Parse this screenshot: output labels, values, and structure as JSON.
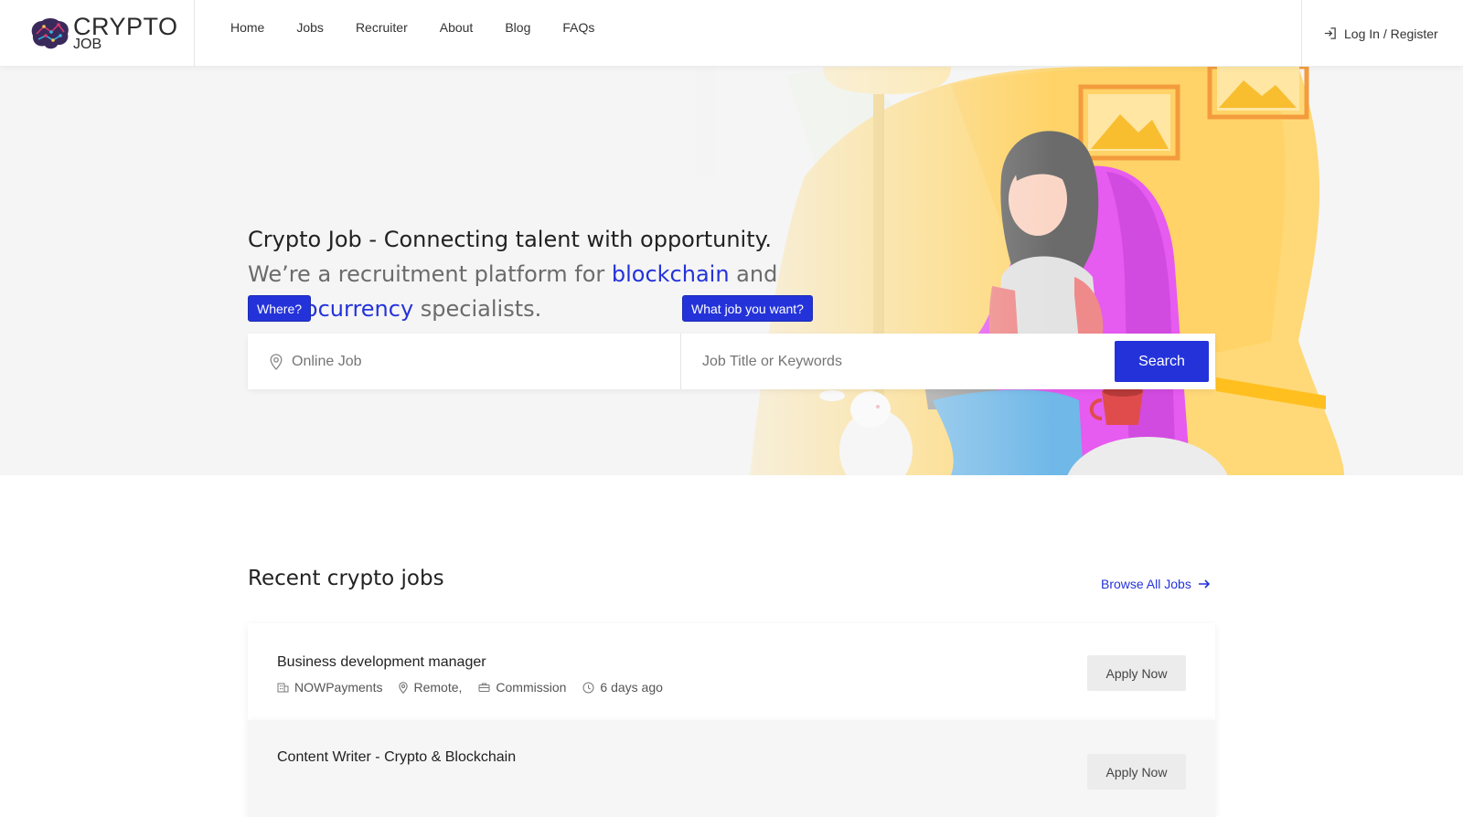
{
  "brand": {
    "line1": "CRYPTO",
    "line2": "JOB"
  },
  "nav": {
    "items": [
      "Home",
      "Jobs",
      "Recruiter",
      "About",
      "Blog",
      "FAQs"
    ]
  },
  "auth": {
    "label": "Log In / Register"
  },
  "hero": {
    "headline": "Crypto Job - Connecting talent with opportunity.",
    "sub_prefix": "We’re a recruitment platform for ",
    "sub_highlight1": "blockchain",
    "sub_mid": " and",
    "sub_highlight2": "cryptocurrency",
    "sub_suffix": " specialists."
  },
  "search": {
    "where_label": "Where?",
    "what_label": "What job you want?",
    "where_placeholder": "Online Job",
    "what_placeholder": "Job Title or Keywords",
    "button": "Search"
  },
  "recent": {
    "title": "Recent crypto jobs",
    "browse_all": "Browse All Jobs"
  },
  "jobs": [
    {
      "title": "Business development manager",
      "company": "NOWPayments",
      "location": "Remote,",
      "type": "Commission",
      "posted": "6 days ago",
      "apply": "Apply Now"
    },
    {
      "title": "Content Writer - Crypto & Blockchain",
      "company": "",
      "location": "",
      "type": "",
      "posted": "",
      "apply": "Apply Now"
    }
  ],
  "colors": {
    "accent": "#2433d9",
    "hero_bg": "#f5f5f5",
    "yellow": "#ffd46b",
    "magenta": "#e65bf0"
  },
  "icons": [
    "brain-logo-icon",
    "login-icon",
    "location-pin-icon",
    "arrow-right-icon",
    "building-icon",
    "briefcase-icon",
    "clock-icon"
  ]
}
